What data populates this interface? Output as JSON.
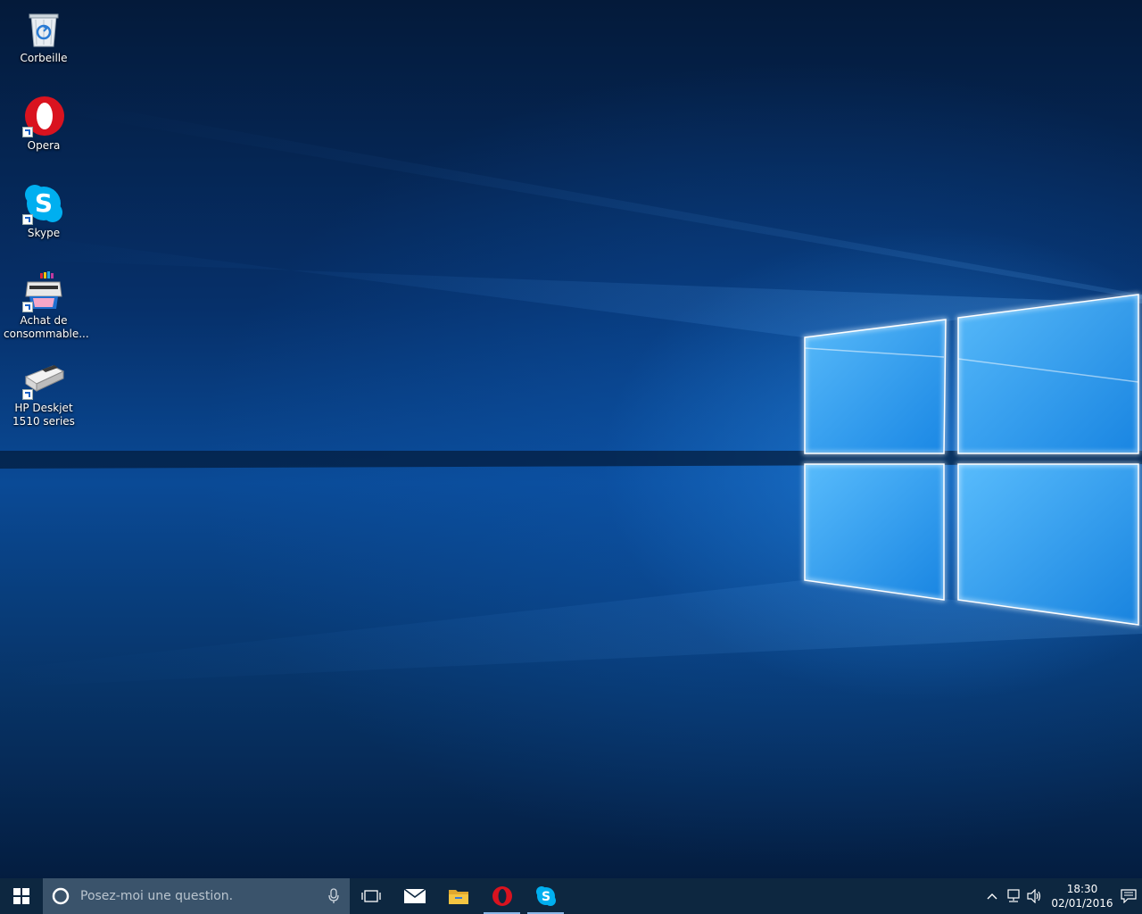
{
  "desktop": {
    "icons": [
      {
        "label": "Corbeille",
        "icon": "recycle-bin-icon"
      },
      {
        "label": "Opera",
        "icon": "opera-icon",
        "shortcut": true
      },
      {
        "label": "Skype",
        "icon": "skype-icon",
        "shortcut": true
      },
      {
        "label": "Achat de consommable...",
        "icon": "printer-supplies-icon",
        "shortcut": true
      },
      {
        "label": "HP Deskjet 1510 series",
        "icon": "hp-printer-icon",
        "shortcut": true
      }
    ]
  },
  "taskbar": {
    "start_icon": "windows-logo-icon",
    "search": {
      "placeholder": "Posez-moi une question.",
      "cortana_icon": "cortana-ring-icon",
      "mic_icon": "microphone-icon"
    },
    "task_view_icon": "task-view-icon",
    "pinned": [
      {
        "name": "mail",
        "icon": "mail-icon",
        "active": false
      },
      {
        "name": "file-explorer",
        "icon": "folder-icon",
        "active": false
      },
      {
        "name": "opera",
        "icon": "opera-icon",
        "active": true
      },
      {
        "name": "skype",
        "icon": "skype-icon",
        "active": true
      }
    ],
    "tray": {
      "icons": [
        "chevron-up-icon",
        "network-icon",
        "volume-icon"
      ],
      "time": "18:30",
      "date": "02/01/2016",
      "notification_icon": "action-center-icon"
    }
  },
  "colors": {
    "taskbar_bg": "#0d2740",
    "search_bg": "#3a536b",
    "opera_red": "#d9131f",
    "skype_blue": "#00aff0",
    "folder_yellow": "#f4c542"
  }
}
